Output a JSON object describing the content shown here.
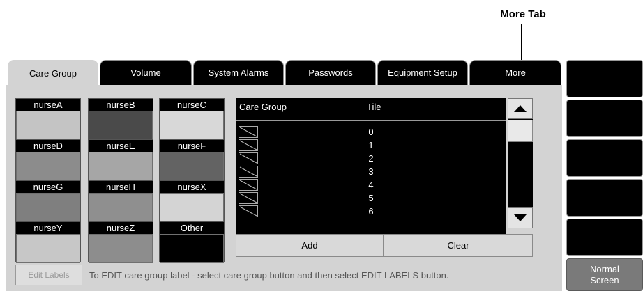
{
  "callout": {
    "text": "More Tab"
  },
  "tabs": [
    {
      "label": "Care Group",
      "active": true
    },
    {
      "label": "Volume"
    },
    {
      "label": "System Alarms"
    },
    {
      "label": "Passwords"
    },
    {
      "label": "Equipment Setup"
    },
    {
      "label": "More"
    }
  ],
  "care_groups": [
    {
      "label": "nurseA",
      "color": "#c4c4c4"
    },
    {
      "label": "nurseB",
      "color": "#4a4a4a"
    },
    {
      "label": "nurseC",
      "color": "#d8d8d8"
    },
    {
      "label": "nurseD",
      "color": "#8c8c8c"
    },
    {
      "label": "nurseE",
      "color": "#a6a6a6"
    },
    {
      "label": "nurseF",
      "color": "#636363"
    },
    {
      "label": "nurseG",
      "color": "#7f7f7f"
    },
    {
      "label": "nurseH",
      "color": "#8f8f8f"
    },
    {
      "label": "nurseX",
      "color": "#d4d4d4"
    },
    {
      "label": "nurseY",
      "color": "#c7c7c7"
    },
    {
      "label": "nurseZ",
      "color": "#8d8d8d"
    },
    {
      "label": "Other",
      "color": "#000000"
    }
  ],
  "table": {
    "col_care_group": "Care Group",
    "col_tile": "Tile",
    "rows": [
      "0",
      "1",
      "2",
      "3",
      "4",
      "5",
      "6"
    ]
  },
  "actions": {
    "add": "Add",
    "clear": "Clear"
  },
  "edit_labels": "Edit Labels",
  "hint": "To EDIT care group label - select care group button and then select EDIT LABELS button.",
  "side_keys": {
    "normal_screen_line1": "Normal",
    "normal_screen_line2": "Screen"
  }
}
